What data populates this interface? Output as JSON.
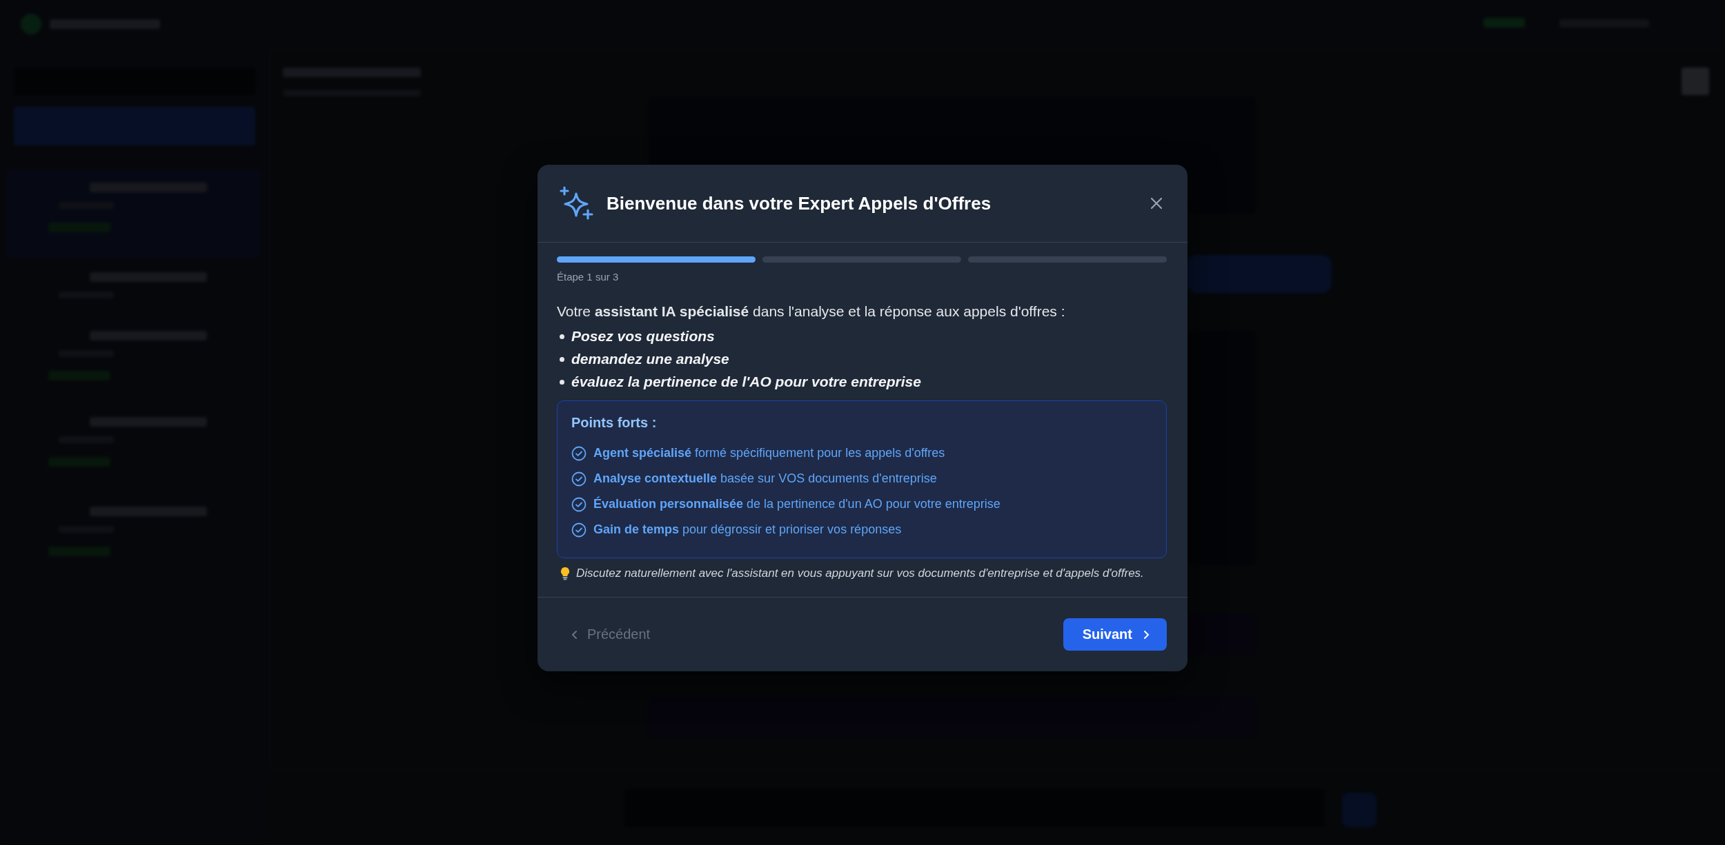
{
  "dialog": {
    "title": "Bienvenue dans votre Expert Appels d'Offres",
    "steps": [
      {
        "filled": true
      },
      {
        "filled": false
      },
      {
        "filled": false
      }
    ],
    "step_label": "Étape 1 sur 3",
    "intro": "Votre **assistant IA spécialisé** dans l'analyse et la réponse aux appels d'offres :",
    "bullets": [
      "Posez vos questions",
      "demandez une analyse",
      "évaluez la pertinence de l'AO pour votre entreprise"
    ],
    "highlights": {
      "title": "Points forts :",
      "items": [
        "**Agent spécialisé** formé spécifiquement pour les appels d'offres",
        "**Analyse contextuelle** basée sur VOS documents d'entreprise",
        "**Évaluation personnalisée** de la pertinence d'un AO pour votre entreprise",
        "**Gain de temps** pour dégrossir et prioriser vos réponses"
      ]
    },
    "tip": "Discutez naturellement avec l'assistant en vous appuyant sur vos documents d'entreprise et d'appels d'offres.",
    "previous": {
      "label": "Précédent",
      "disabled": true
    },
    "next": {
      "label": "Suivant",
      "disabled": false
    }
  }
}
